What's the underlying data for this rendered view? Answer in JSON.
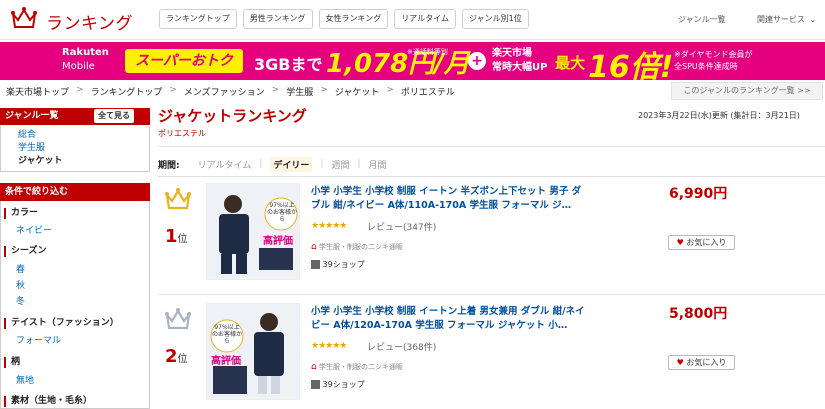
{
  "header": {
    "logo_text": "ランキング",
    "tabs": [
      "ランキングトップ",
      "男性ランキング",
      "女性ランキング",
      "リアルタイム",
      "ジャンル別1位"
    ],
    "right_links": [
      "ジャンル一覧",
      "関連サービス"
    ]
  },
  "banner": {
    "brand_line1": "Rakuten",
    "brand_line2": "Mobile",
    "super_label": "スーパーおトク",
    "gb_text": "3GBまで",
    "price_text": "1,078円/月",
    "note_a": "※通話料等別",
    "plus": "+",
    "ichiba_line1": "楽天市場",
    "ichiba_line2": "常時大幅UP",
    "max_label": "最大",
    "multiplier": "16倍!",
    "note_b_line1": "※ダイヤモンド会員が",
    "note_b_line2": "全SPU条件達成時"
  },
  "breadcrumb": [
    "楽天市場トップ",
    "ランキングトップ",
    "メンズファッション",
    "学生服",
    "ジャケット",
    "ポリエステル"
  ],
  "breadcrumb_right": "このジャンルのランキング一覧 >>",
  "sidebar": {
    "genre_title": "ジャンル一覧",
    "see_all": "全て見る",
    "genres": [
      "総合",
      "学生服",
      "ジャケット"
    ],
    "filter_title": "条件で絞り込む",
    "filters": [
      {
        "name": "カラー",
        "options": [
          "ネイビー"
        ]
      },
      {
        "name": "シーズン",
        "options": [
          "春",
          "秋",
          "冬"
        ]
      },
      {
        "name": "テイスト（ファッション）",
        "options": [
          "フォーマル"
        ]
      },
      {
        "name": "柄",
        "options": [
          "無地"
        ]
      },
      {
        "name": "素材（生地・毛糸）",
        "options": []
      }
    ]
  },
  "main": {
    "title": "ジャケットランキング",
    "subtitle": "ポリエステル",
    "date_info": "2023年3月22日(水)更新 (集計日：3月21日)",
    "period_label": "期間:",
    "periods": [
      "リアルタイム",
      "デイリー",
      "週間",
      "月間"
    ],
    "active_period": "デイリー"
  },
  "items": [
    {
      "rank": "1",
      "rank_suffix": "位",
      "name": "小学 小学生 小学校 制服 イートン 半ズボン上下セット 男子 ダブル 紺/ネイビー A体/110A-170A 学生服 フォーマル ジ…",
      "stars": "★★★★★",
      "review": "レビュー(347件)",
      "shop_line": "学生服・制服の二シキ通販",
      "shop": "39ショップ",
      "price": "6,990円",
      "fav": "お気に入り",
      "thumb_badge": "97%以上のお客様から",
      "thumb_rating": "高評価"
    },
    {
      "rank": "2",
      "rank_suffix": "位",
      "name": "小学 小学生 小学校 制服 イートン上着 男女兼用 ダブル 紺/ネイビー A体/120A-170A 学生服 フォーマル ジャケット 小…",
      "stars": "★★★★★",
      "review": "レビュー(368件)",
      "shop_line": "学生服・制服の二シキ通販",
      "shop": "39ショップ",
      "price": "5,800円",
      "fav": "お気に入り",
      "thumb_badge": "97%以上のお客様から",
      "thumb_rating": "高評価"
    }
  ],
  "colors": {
    "accent": "#bf0000",
    "banner": "#e4007f",
    "banner_highlight": "#fff100",
    "link": "#0050a0",
    "gold": "#e6b422",
    "silver": "#a9b4c2"
  }
}
